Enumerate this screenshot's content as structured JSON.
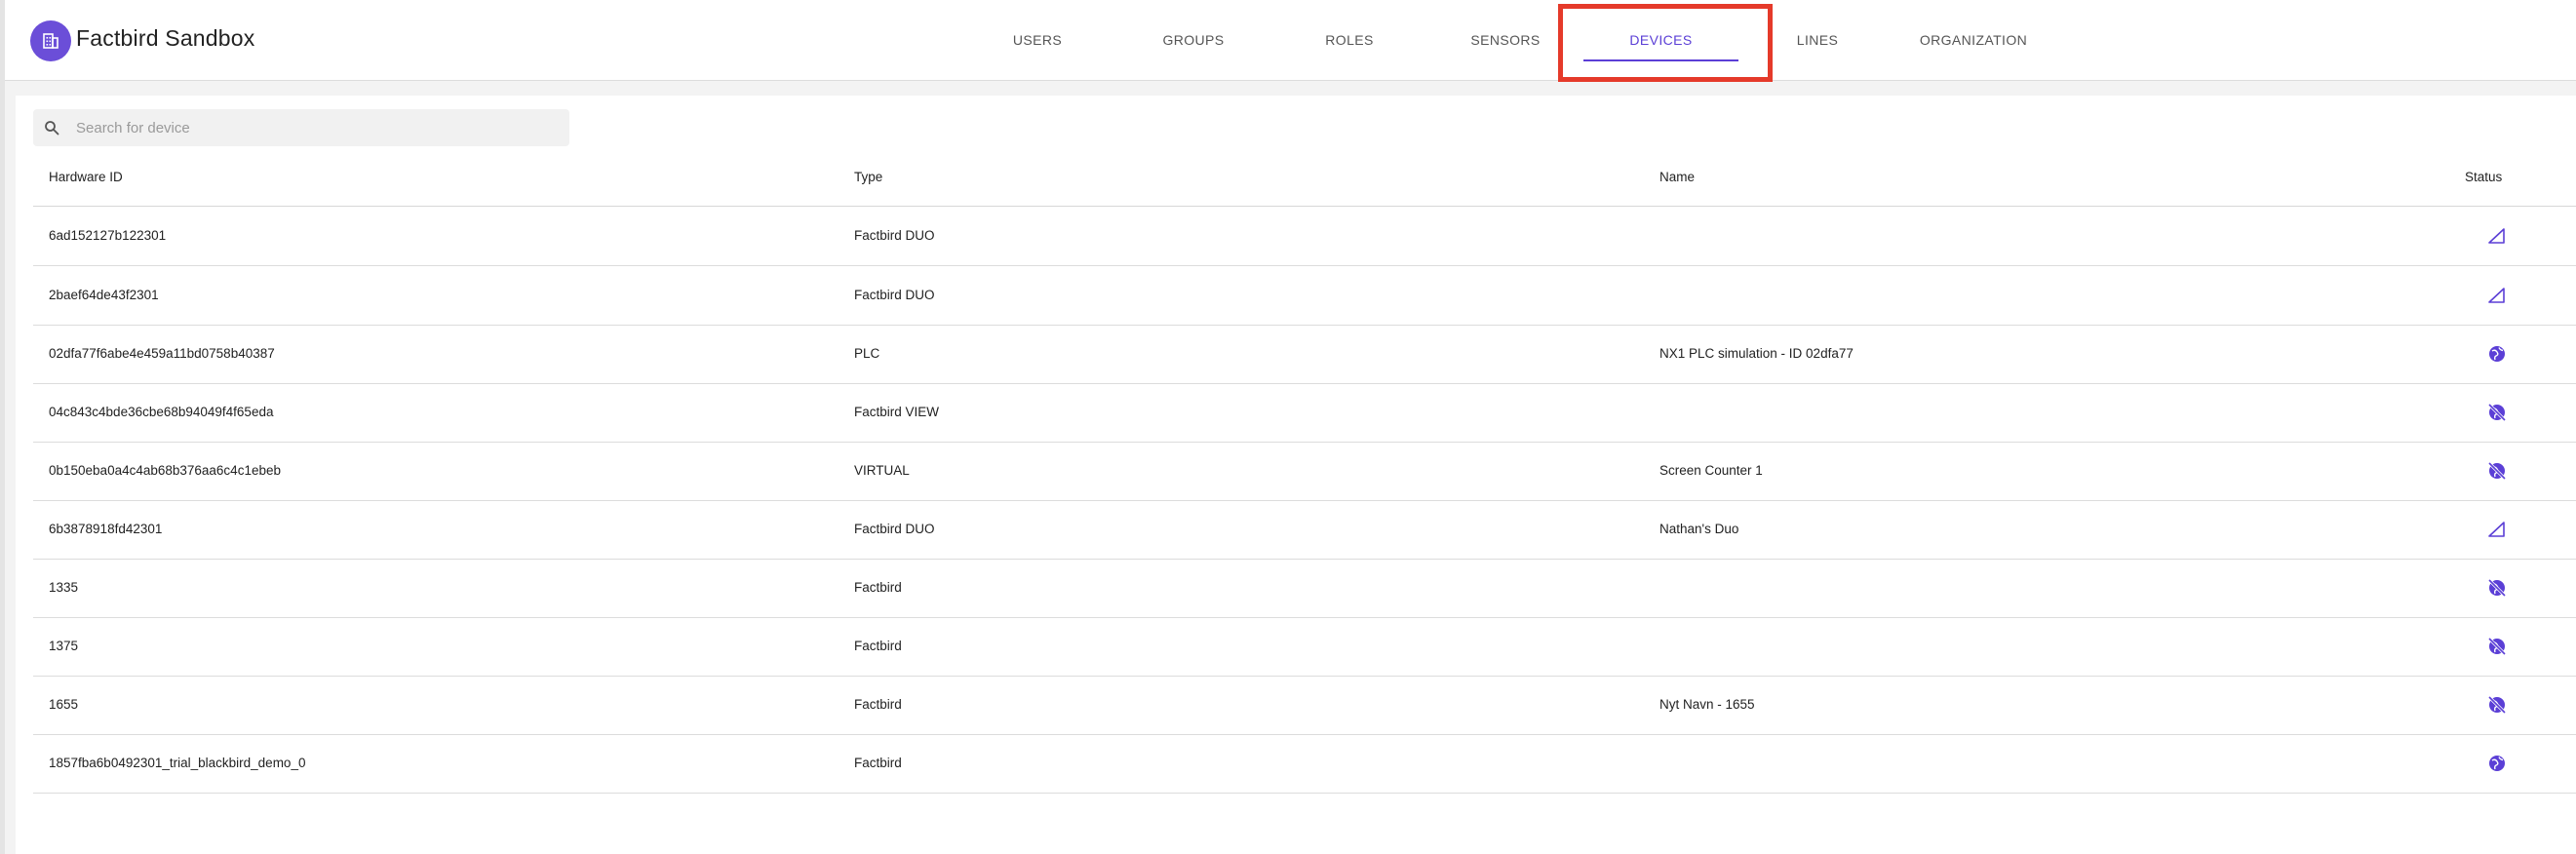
{
  "app": {
    "title": "Factbird Sandbox"
  },
  "nav": {
    "tabs": [
      {
        "label": "USERS",
        "active": false
      },
      {
        "label": "GROUPS",
        "active": false
      },
      {
        "label": "ROLES",
        "active": false
      },
      {
        "label": "SENSORS",
        "active": false
      },
      {
        "label": "DEVICES",
        "active": true
      },
      {
        "label": "LINES",
        "active": false
      },
      {
        "label": "ORGANIZATION",
        "active": false
      }
    ]
  },
  "search": {
    "placeholder": "Search for device"
  },
  "table": {
    "columns": [
      "Hardware ID",
      "Type",
      "Name",
      "Status"
    ],
    "rows": [
      {
        "hardware_id": "6ad152127b122301",
        "type": "Factbird DUO",
        "name": "",
        "status_icon": "signal-icon"
      },
      {
        "hardware_id": "2baef64de43f2301",
        "type": "Factbird DUO",
        "name": "",
        "status_icon": "signal-icon"
      },
      {
        "hardware_id": "02dfa77f6abe4e459a11bd0758b40387",
        "type": "PLC",
        "name": "NX1 PLC simulation - ID 02dfa77",
        "status_icon": "globe-icon"
      },
      {
        "hardware_id": "04c843c4bde36cbe68b94049f4f65eda",
        "type": "Factbird VIEW",
        "name": "",
        "status_icon": "globe-off-icon"
      },
      {
        "hardware_id": "0b150eba0a4c4ab68b376aa6c4c1ebeb",
        "type": "VIRTUAL",
        "name": "Screen Counter 1",
        "status_icon": "globe-off-icon"
      },
      {
        "hardware_id": "6b3878918fd42301",
        "type": "Factbird DUO",
        "name": "Nathan's Duo",
        "status_icon": "signal-icon"
      },
      {
        "hardware_id": "1335",
        "type": "Factbird",
        "name": "",
        "status_icon": "globe-off-icon"
      },
      {
        "hardware_id": "1375",
        "type": "Factbird",
        "name": "",
        "status_icon": "globe-off-icon"
      },
      {
        "hardware_id": "1655",
        "type": "Factbird",
        "name": "Nyt Navn - 1655",
        "status_icon": "globe-off-icon"
      },
      {
        "hardware_id": "1857fba6b0492301_trial_blackbird_demo_0",
        "type": "Factbird",
        "name": "",
        "status_icon": "globe-icon"
      }
    ]
  },
  "colors": {
    "accent": "#5b3fd6",
    "highlight": "#e53a2a",
    "logo": "#6b4ed8"
  }
}
